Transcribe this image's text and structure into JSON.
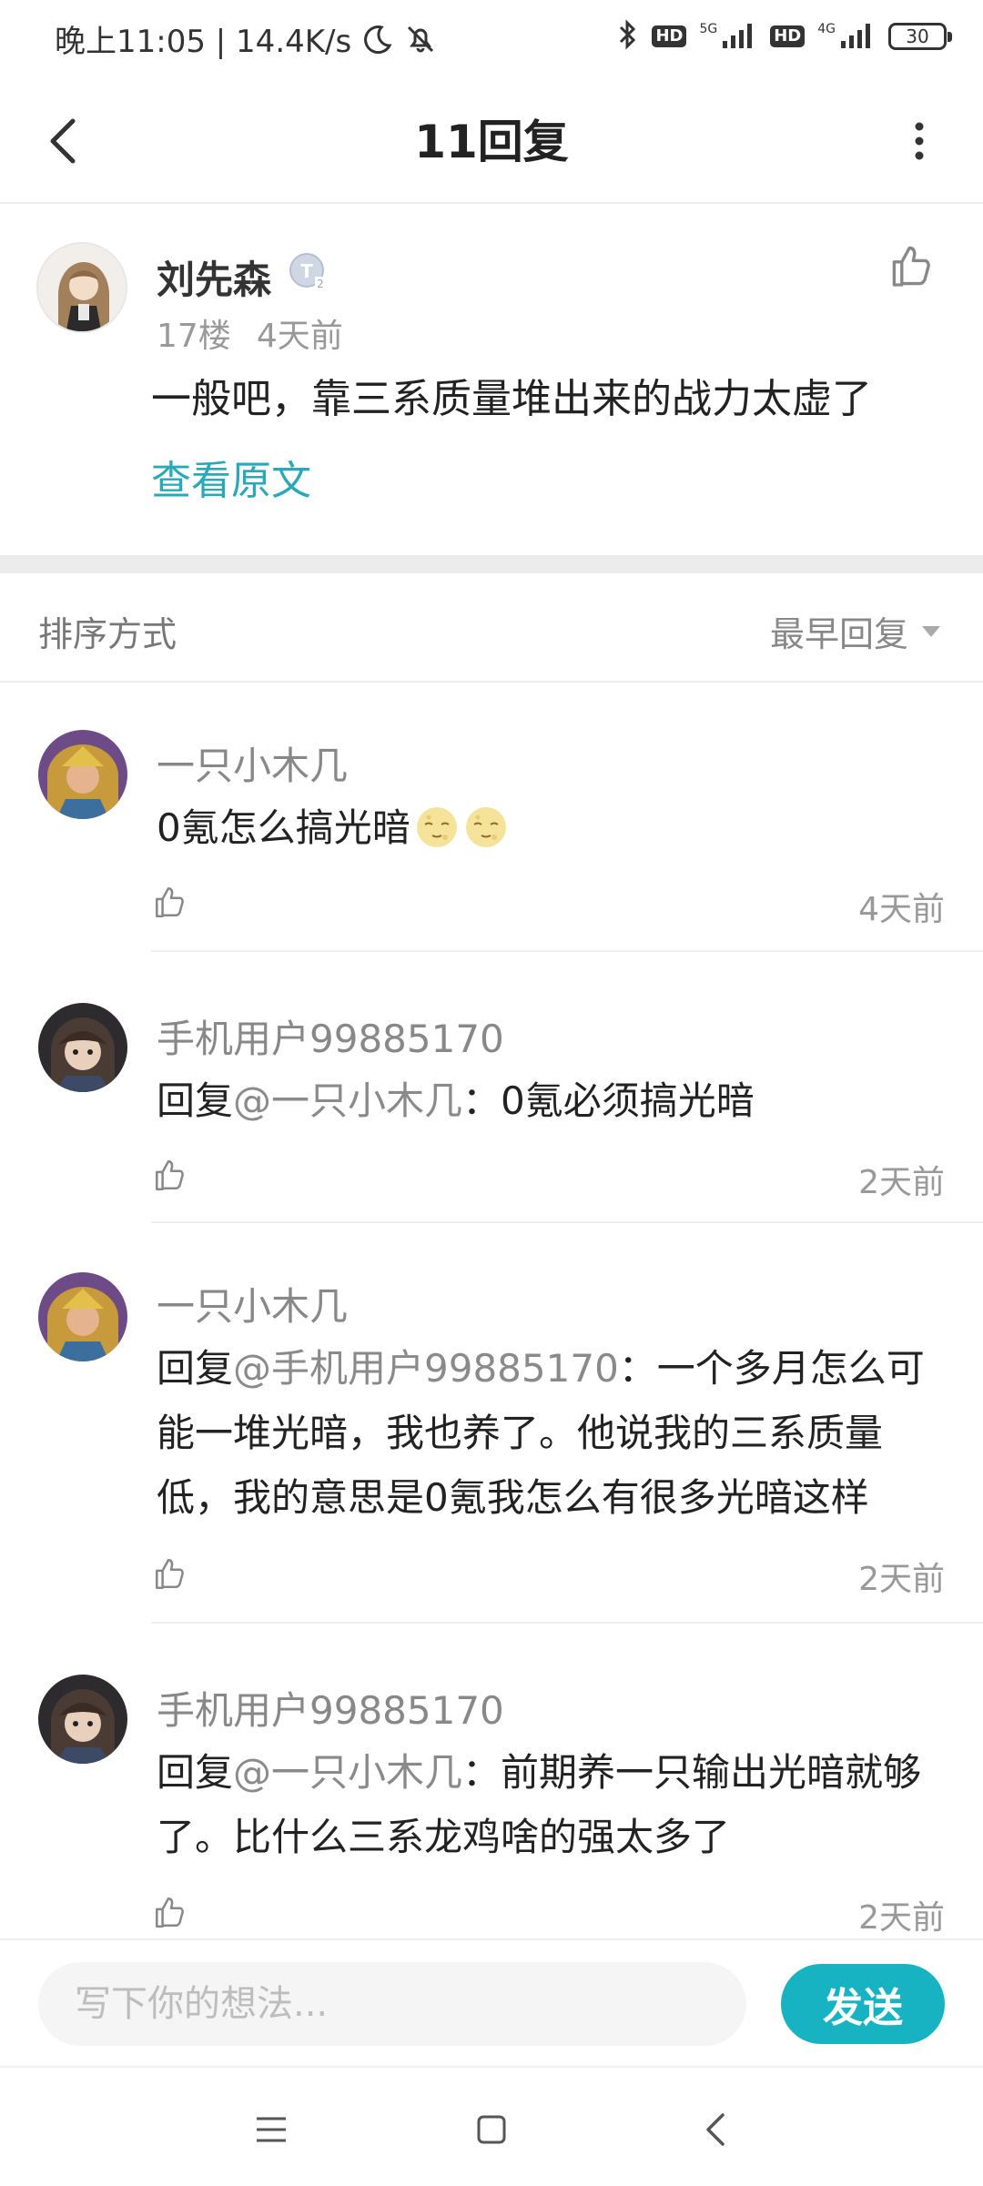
{
  "status_bar": {
    "left_text": "晚上11:05 | 14.4K/s",
    "hd1": "HD",
    "hd2": "HD",
    "net1": "5G",
    "net2": "4G",
    "battery": "30",
    "icons": [
      "moon-icon",
      "mute-bell-icon",
      "bluetooth-icon",
      "signal-icon",
      "battery-icon"
    ]
  },
  "header": {
    "title": "11回复",
    "icons": [
      "back-arrow-icon",
      "more-vertical-icon"
    ]
  },
  "main_post": {
    "author": "刘先森",
    "floor": "17楼",
    "time": "4天前",
    "content": "一般吧，靠三系质量堆出来的战力太虚了",
    "view_original": "查看原文"
  },
  "sort": {
    "label": "排序方式",
    "selected": "最早回复"
  },
  "replies": [
    {
      "name": "一只小木几",
      "prefix": "",
      "mention": "",
      "text": "0氪怎么搞光暗",
      "time": "4天前"
    },
    {
      "name": "手机用户99885170",
      "prefix": "回复",
      "mention": "@一只小木几",
      "text": "：0氪必须搞光暗",
      "time": "2天前"
    },
    {
      "name": "一只小木几",
      "prefix": "回复",
      "mention": "@手机用户99885170",
      "text": "：一个多月怎么可能一堆光暗，我也养了。他说我的三系质量低，我的意思是0氪我怎么有很多光暗这样",
      "time": "2天前"
    },
    {
      "name": "手机用户99885170",
      "prefix": "回复",
      "mention": "@一只小木几",
      "text": "：前期养一只输出光暗就够了。比什么三系龙鸡啥的强太多了",
      "time": "2天前"
    }
  ],
  "composer": {
    "placeholder": "写下你的想法...",
    "send_label": "发送"
  },
  "colors": {
    "accent": "#17b3c3",
    "link": "#29a9b8"
  }
}
